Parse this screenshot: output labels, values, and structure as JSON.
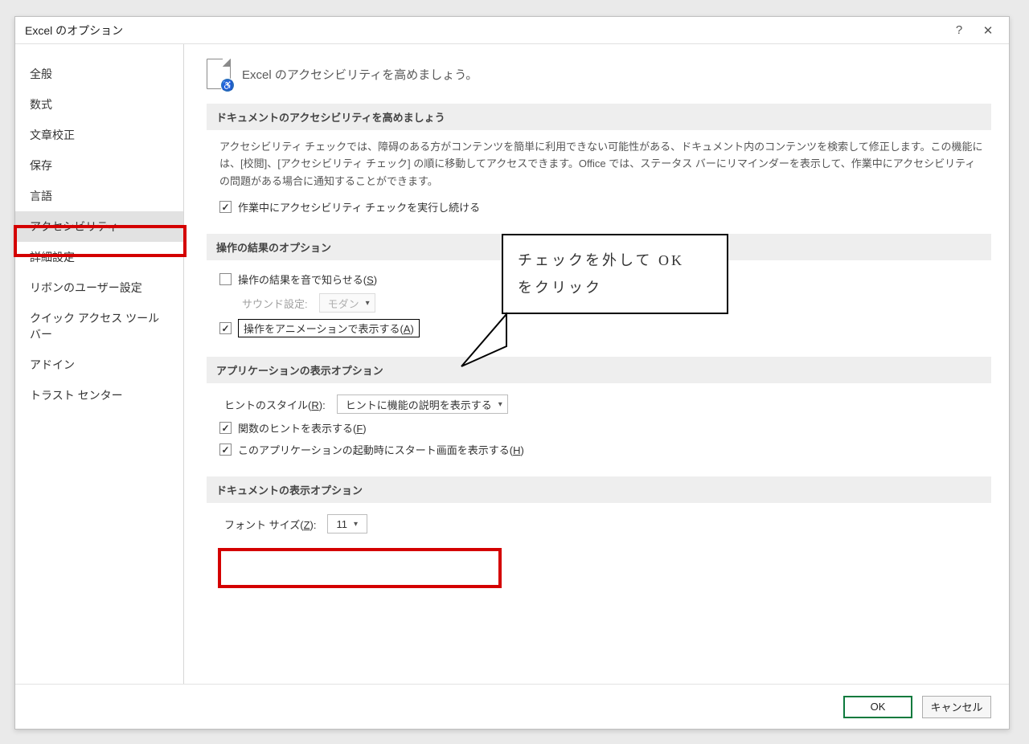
{
  "window": {
    "title": "Excel のオプション"
  },
  "titlebar": {
    "help_icon": "?",
    "close_icon": "✕"
  },
  "sidebar": {
    "items": [
      {
        "label": "全般"
      },
      {
        "label": "数式"
      },
      {
        "label": "文章校正"
      },
      {
        "label": "保存"
      },
      {
        "label": "言語"
      },
      {
        "label": "アクセシビリティ",
        "selected": true
      },
      {
        "label": "詳細設定"
      },
      {
        "label": "リボンのユーザー設定"
      },
      {
        "label": "クイック アクセス ツール バー"
      },
      {
        "label": "アドイン"
      },
      {
        "label": "トラスト センター"
      }
    ]
  },
  "banner": {
    "text": "Excel のアクセシビリティを高めましょう。"
  },
  "sections": {
    "doc_a11y": {
      "header": "ドキュメントのアクセシビリティを高めましょう",
      "desc": "アクセシビリティ チェックでは、障碍のある方がコンテンツを簡単に利用できない可能性がある、ドキュメント内のコンテンツを検索して修正します。この機能には、[校閲]、[アクセシビリティ チェック] の順に移動してアクセスできます。Office では、ステータス バーにリマインダーを表示して、作業中にアクセシビリティの問題がある場合に通知することができます。",
      "chk_run_label": "作業中にアクセシビリティ チェックを実行し続ける",
      "chk_run_checked": true
    },
    "feedback": {
      "header": "操作の結果のオプション",
      "chk_sound_label_pre": "操作の結果を音で知らせる(",
      "chk_sound_key": "S",
      "chk_sound_label_post": ")",
      "chk_sound_checked": false,
      "sound_scheme_label": "サウンド設定:",
      "sound_scheme_value": "モダン",
      "chk_anim_label_pre": "操作をアニメーションで表示する(",
      "chk_anim_key": "A",
      "chk_anim_label_post": ")",
      "chk_anim_checked": true
    },
    "app_display": {
      "header": "アプリケーションの表示オプション",
      "hint_style_label_pre": "ヒントのスタイル(",
      "hint_style_key": "R",
      "hint_style_label_post": "):",
      "hint_style_value": "ヒントに機能の説明を表示する",
      "chk_func_hint_label_pre": "関数のヒントを表示する(",
      "chk_func_hint_key": "F",
      "chk_func_hint_label_post": ")",
      "chk_func_hint_checked": true,
      "chk_startscreen_label_pre": "このアプリケーションの起動時にスタート画面を表示する(",
      "chk_startscreen_key": "H",
      "chk_startscreen_label_post": ")",
      "chk_startscreen_checked": true
    },
    "doc_display": {
      "header": "ドキュメントの表示オプション",
      "font_size_label_pre": "フォント サイズ(",
      "font_size_key": "Z",
      "font_size_label_post": "):",
      "font_size_value": "11"
    }
  },
  "footer": {
    "ok": "OK",
    "cancel": "キャンセル"
  },
  "annotation": {
    "line1": "チェックを外して OK",
    "line2": "をクリック"
  }
}
